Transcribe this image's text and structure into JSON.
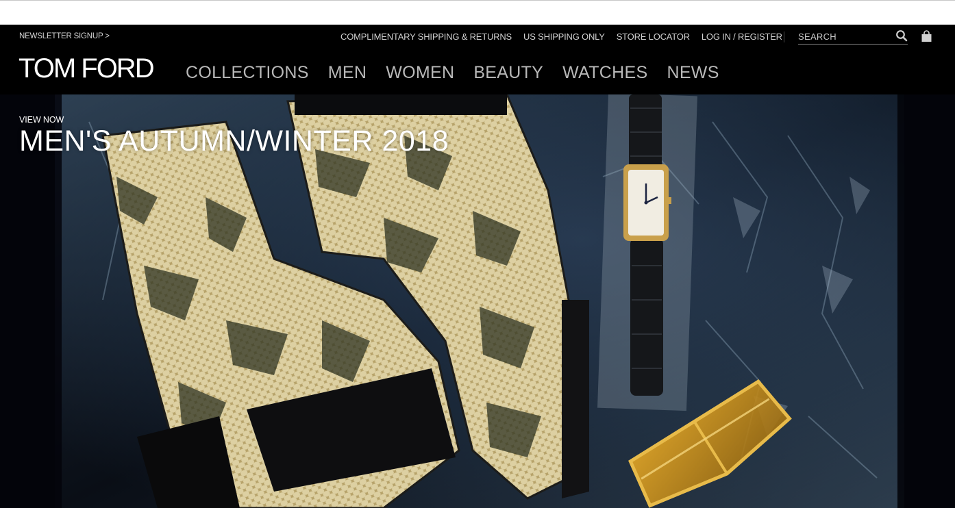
{
  "utility_bar": {
    "newsletter": "NEWSLETTER SIGNUP >",
    "links": [
      "COMPLIMENTARY SHIPPING & RETURNS",
      "US SHIPPING ONLY",
      "STORE LOCATOR",
      "LOG IN / REGISTER"
    ],
    "search_placeholder": "SEARCH",
    "search_icon": "search-icon",
    "bag_icon": "shopping-bag-icon"
  },
  "header": {
    "logo": "TOM FORD",
    "nav": [
      "COLLECTIONS",
      "MEN",
      "WOMEN",
      "BEAUTY",
      "WATCHES",
      "NEWS"
    ]
  },
  "hero": {
    "kicker": "VIEW NOW",
    "title": "MEN'S AUTUMN/WINTER 2018"
  },
  "colors": {
    "header_bg": "#000000",
    "nav_text": "#b8b8b8",
    "utility_text": "#d0d0d0",
    "logo": "#ffffff"
  }
}
